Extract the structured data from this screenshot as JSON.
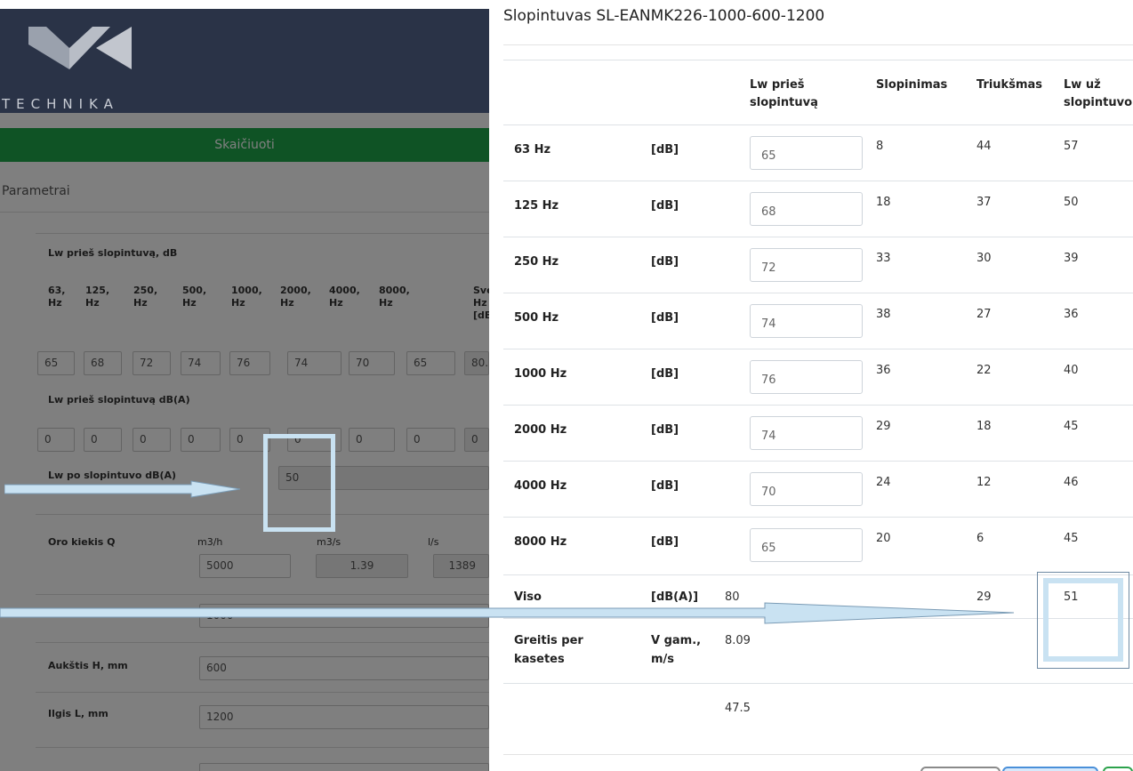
{
  "left": {
    "logo_text": "TECHNIKA",
    "calc_button": "Skaičiuoti",
    "params_title": "Parametrai",
    "lw_before_title": "Lw prieš slopintuvą, dB",
    "freq_headers": [
      [
        "63,",
        "Hz"
      ],
      [
        "125,",
        "Hz"
      ],
      [
        "250,",
        "Hz"
      ],
      [
        "500,",
        "Hz"
      ],
      [
        "1000,",
        "Hz"
      ],
      [
        "2000,",
        "Hz"
      ],
      [
        "4000,",
        "Hz"
      ],
      [
        "8000,",
        "Hz"
      ],
      [
        "Sve",
        "Hz",
        "[dB"
      ]
    ],
    "lw_before_values": [
      "65",
      "68",
      "72",
      "74",
      "76",
      "74",
      "70",
      "65",
      "80."
    ],
    "lw_before_dba_title": "Lw prieš slopintuvą dB(A)",
    "lw_before_dba_values": [
      "0",
      "0",
      "0",
      "0",
      "0",
      "0",
      "0",
      "0",
      "0"
    ],
    "lw_after_dba_label": "Lw po slopintuvo dB(A)",
    "lw_after_dba_value": "50",
    "air_flow_label": "Oro kiekis Q",
    "unit_m3h": "m3/h",
    "unit_m3s": "m3/s",
    "unit_ls": "l/s",
    "air_m3h": "5000",
    "air_m3s": "1.39",
    "air_ls": "1389",
    "width_value": "1000",
    "height_label": "Aukštis H, mm",
    "height_value": "600",
    "length_label": "Ilgis L, mm",
    "length_value": "1200"
  },
  "modal": {
    "title": "Slopintuvas SL-EANMK226-1000-600-1200",
    "headers": {
      "lw_before": [
        "Lw prieš",
        "slopintuvą"
      ],
      "attenuation": "Slopinimas",
      "noise": "Triukšmas",
      "lw_after": [
        "Lw už",
        "slopintuvo"
      ]
    },
    "rows": [
      {
        "freq": "63 Hz",
        "unit": "[dB]",
        "lw": "65",
        "att": "8",
        "noise": "44",
        "after": "57"
      },
      {
        "freq": "125 Hz",
        "unit": "[dB]",
        "lw": "68",
        "att": "18",
        "noise": "37",
        "after": "50"
      },
      {
        "freq": "250 Hz",
        "unit": "[dB]",
        "lw": "72",
        "att": "33",
        "noise": "30",
        "after": "39"
      },
      {
        "freq": "500 Hz",
        "unit": "[dB]",
        "lw": "74",
        "att": "38",
        "noise": "27",
        "after": "36"
      },
      {
        "freq": "1000 Hz",
        "unit": "[dB]",
        "lw": "76",
        "att": "36",
        "noise": "22",
        "after": "40"
      },
      {
        "freq": "2000 Hz",
        "unit": "[dB]",
        "lw": "74",
        "att": "29",
        "noise": "18",
        "after": "45"
      },
      {
        "freq": "4000 Hz",
        "unit": "[dB]",
        "lw": "70",
        "att": "24",
        "noise": "12",
        "after": "46"
      },
      {
        "freq": "8000 Hz",
        "unit": "[dB]",
        "lw": "65",
        "att": "20",
        "noise": "6",
        "after": "45"
      }
    ],
    "total": {
      "label": "Viso",
      "unit": "[dB(A)]",
      "lw": "80",
      "noise": "29",
      "after": "51"
    },
    "speed": {
      "label": [
        "Greitis per",
        "kasetes"
      ],
      "unit": [
        "V gam.,",
        "m/s"
      ],
      "value": "8.09"
    },
    "extra_value": "47.5"
  },
  "colors": {
    "header_bg": "#2a3347",
    "calc_green": "#1ea64a",
    "annotation_blue": "#c9e2f2"
  }
}
